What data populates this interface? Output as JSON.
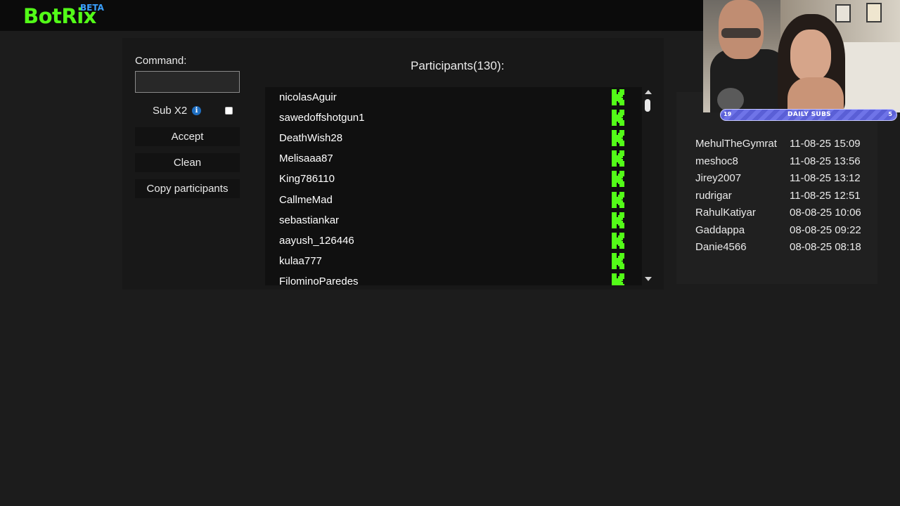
{
  "app": {
    "logo": "BotRix",
    "logo_badge": "BETA"
  },
  "controls": {
    "command_label": "Command:",
    "command_value": "",
    "subx2_label": "Sub X2",
    "subx2_checked": false,
    "accept_label": "Accept",
    "clean_label": "Clean",
    "copy_label": "Copy participants"
  },
  "participants": {
    "title": "Participants(130):",
    "platform_icon": "kick-icon",
    "items": [
      "nicolasAguir",
      "sawedoffshotgun1",
      "DeathWish28",
      "Melisaaa87",
      "King786110",
      "CallmeMad",
      "sebastiankar",
      "aayush_126446",
      "kulaa777",
      "FilominoParedes"
    ]
  },
  "subs_list": {
    "rows": [
      {
        "name": "MehulTheGymrat",
        "time": "11-08-25 15:09"
      },
      {
        "name": "meshoc8",
        "time": "11-08-25 13:56"
      },
      {
        "name": "Jirey2007",
        "time": "11-08-25 13:12"
      },
      {
        "name": "rudrigar",
        "time": "11-08-25 12:51"
      },
      {
        "name": "RahulKatiyar",
        "time": "08-08-25 10:06"
      },
      {
        "name": "Gaddappa",
        "time": "08-08-25 09:22"
      },
      {
        "name": "Danie4566",
        "time": "08-08-25 08:18"
      }
    ]
  },
  "webcam": {
    "subs_bar_label": "DAILY SUBS",
    "subs_bar_current": "19",
    "subs_bar_goal": "5"
  },
  "colors": {
    "brand": "#53fc18",
    "beta": "#3aa0ff",
    "background": "#1c1c1c",
    "kick_green": "#53fc18"
  }
}
